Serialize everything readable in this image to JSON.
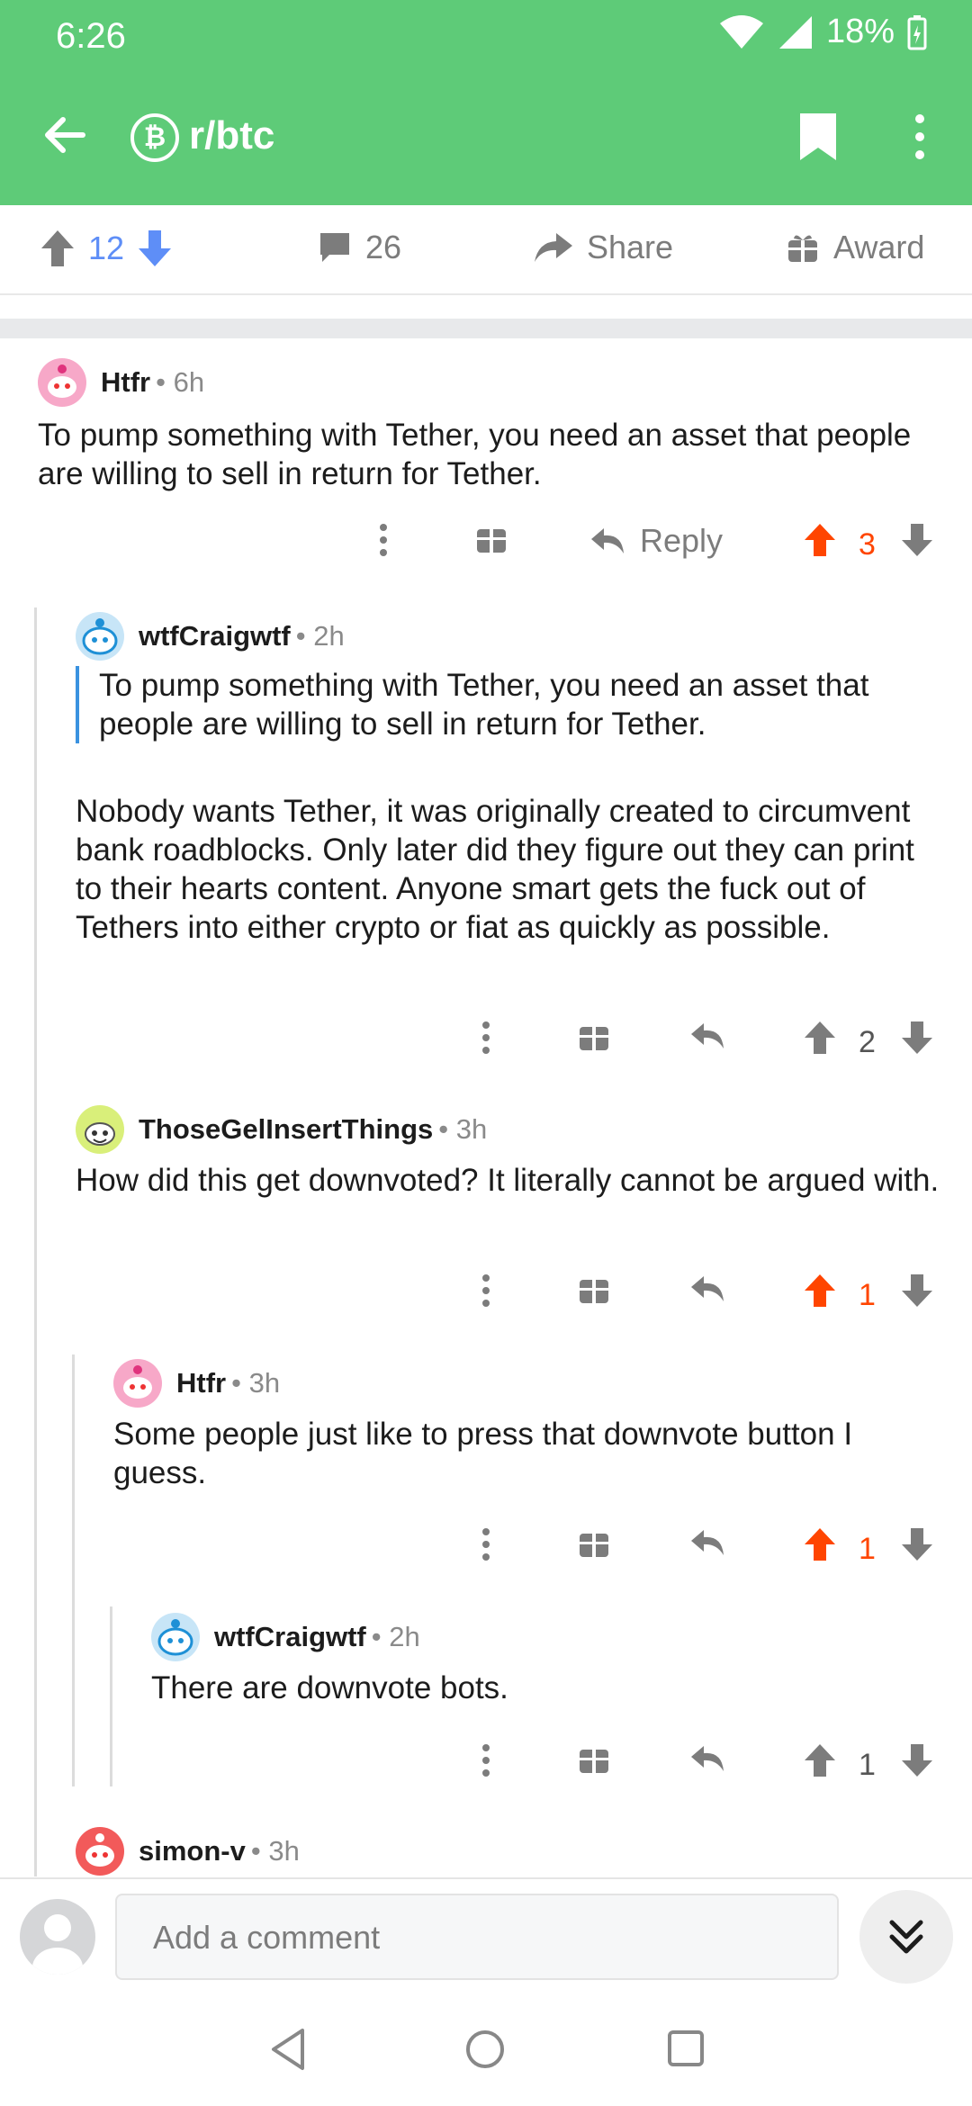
{
  "status": {
    "time": "6:26",
    "battery": "18%"
  },
  "header": {
    "subreddit": "r/btc",
    "sub_icon": "₿"
  },
  "post_actions": {
    "score": "12",
    "comments": "26",
    "share": "Share",
    "award": "Award"
  },
  "comments": [
    {
      "user": "Htfr",
      "time": "6h",
      "body": "To pump something with Tether, you need an asset that people are willing to sell in return for Tether.",
      "reply": "Reply",
      "score": "3"
    },
    {
      "user": "wtfCraigwtf",
      "time": "2h",
      "quote": "To pump something with Tether, you need an asset that people are willing to sell in return for Tether.",
      "body": "Nobody wants Tether, it was originally created to circumvent bank roadblocks. Only later did they figure out they can print to their hearts content. Anyone smart gets the fuck out of Tethers into either crypto or fiat as quickly as possible.",
      "score": "2"
    },
    {
      "user": "ThoseGelInsertThings",
      "time": "3h",
      "body": "How did this get downvoted? It literally cannot be argued with.",
      "score": "1"
    },
    {
      "user": "Htfr",
      "time": "3h",
      "body": "Some people just like to press that downvote button I guess.",
      "score": "1"
    },
    {
      "user": "wtfCraigwtf",
      "time": "2h",
      "body": "There are downvote bots.",
      "score": "1"
    },
    {
      "user": "simon-v",
      "time": "3h"
    }
  ],
  "composer": {
    "placeholder": "Add a comment"
  },
  "colors": {
    "header": "#5ecb78",
    "upvote": "#ff4500",
    "downvote_blue": "#5e8ef7",
    "quote_bar": "#3a92e0"
  }
}
